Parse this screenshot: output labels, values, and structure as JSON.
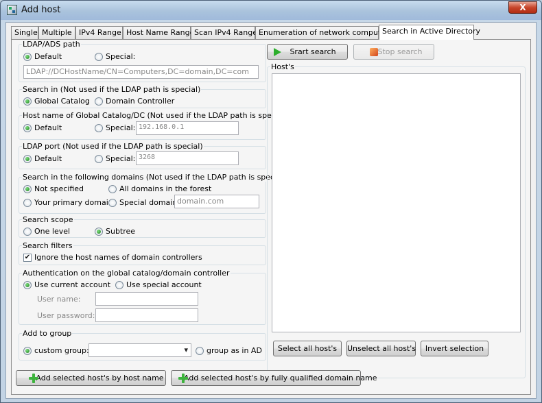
{
  "window": {
    "title": "Add host",
    "close_label": "X"
  },
  "tabs": [
    "Single",
    "Multiple",
    "IPv4 Range",
    "Host Name Range",
    "Scan IPv4 Range",
    "Enumeration of network computers",
    "Search in Active Directory"
  ],
  "ldap_path": {
    "title": "LDAP/ADS path",
    "default_label": "Default",
    "special_label": "Special:",
    "path_value": "LDAP://DCHostName/CN=Computers,DC=domain,DC=com"
  },
  "search_in": {
    "title": "Search in (Not used if the LDAP path is special)",
    "global_catalog": "Global Catalog",
    "domain_controller": "Domain Controller"
  },
  "host_name": {
    "title": "Host name of Global Catalog/DC (Not used if the LDAP path is special)",
    "default_label": "Default",
    "special_label": "Special:",
    "value": "192.168.0.1"
  },
  "ldap_port": {
    "title": "LDAP port (Not used if the LDAP path is special)",
    "default_label": "Default",
    "special_label": "Special:",
    "value": "3268"
  },
  "domains": {
    "title": "Search in the following domains (Not used if the LDAP path is special)",
    "not_specified": "Not specified",
    "all_domains": "All domains in the forest",
    "primary_domain": "Your primary domain",
    "special_domain": "Special domain:",
    "special_value": "domain.com"
  },
  "scope": {
    "title": "Search scope",
    "one_level": "One level",
    "subtree": "Subtree"
  },
  "filters": {
    "title": "Search filters",
    "ignore_dc": "Ignore the host names of domain controllers",
    "check_mark": "✔"
  },
  "auth": {
    "title": "Authentication on the global catalog/domain controller",
    "current_account": "Use current account",
    "special_account": "Use special account",
    "user_name_label": "User name:",
    "password_label": "User password:"
  },
  "group": {
    "title": "Add to group",
    "custom_group": "custom group:",
    "group_as_in_ad": "group as in AD"
  },
  "right": {
    "start_search": "Srart search",
    "stop_search": "Stop search",
    "hosts_label": "Host's",
    "select_all": "Select all host's",
    "unselect_all": "Unselect all host's",
    "invert": "Invert selection"
  },
  "bottom": {
    "add_by_name": "Add selected host's by host name",
    "add_by_fqdn": "Add selected host's by fully qualified domain name"
  }
}
